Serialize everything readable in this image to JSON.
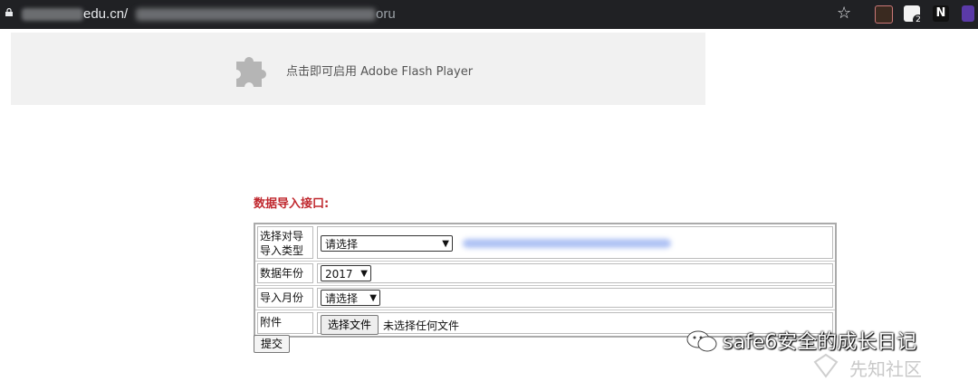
{
  "browser": {
    "url_visible": "edu.cn/",
    "url_tail": "oru"
  },
  "flash": {
    "message": "点击即可启用 Adobe Flash Player"
  },
  "form": {
    "title": "数据导入接口:",
    "rows": [
      {
        "label": "选择对导导入类型",
        "value": "请选择"
      },
      {
        "label": "数据年份",
        "value": "2017"
      },
      {
        "label": "导入月份",
        "value": "请选择"
      },
      {
        "label": "附件",
        "button": "选择文件",
        "status": "未选择任何文件"
      }
    ],
    "submit": "提交"
  },
  "watermark": {
    "text": "safe6安全的成长日记",
    "sub": "先知社区"
  }
}
